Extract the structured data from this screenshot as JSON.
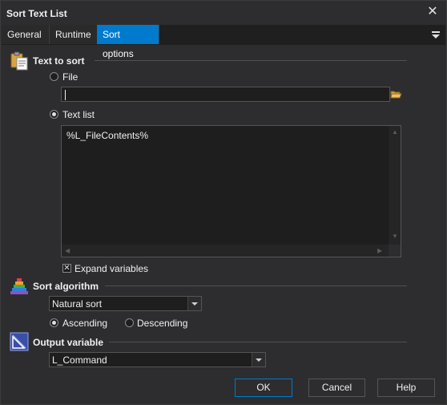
{
  "window": {
    "title": "Sort Text List",
    "close_glyph": "✕"
  },
  "tabs": [
    {
      "label": "General"
    },
    {
      "label": "Runtime"
    },
    {
      "label": "Sort options",
      "active": true
    }
  ],
  "text_to_sort": {
    "heading": "Text to sort",
    "icon": "clipboard-icon",
    "file_option": {
      "label": "File",
      "selected": false
    },
    "file_value": "",
    "textlist_option": {
      "label": "Text list",
      "selected": true
    },
    "textlist_value": "%L_FileContents%",
    "expand_variables": {
      "label": "Expand variables",
      "checked": true
    }
  },
  "sort_algorithm": {
    "heading": "Sort algorithm",
    "icon": "pyramid-icon",
    "selected": "Natural sort",
    "ascending": {
      "label": "Ascending",
      "selected": true
    },
    "descending": {
      "label": "Descending",
      "selected": false
    }
  },
  "output_variable": {
    "heading": "Output variable",
    "icon": "triangle-ruler-icon",
    "selected": "L_Command"
  },
  "buttons": {
    "ok": "OK",
    "cancel": "Cancel",
    "help": "Help"
  },
  "colors": {
    "accent": "#007acc",
    "background": "#2d2d30",
    "field": "#1e1e1e"
  }
}
